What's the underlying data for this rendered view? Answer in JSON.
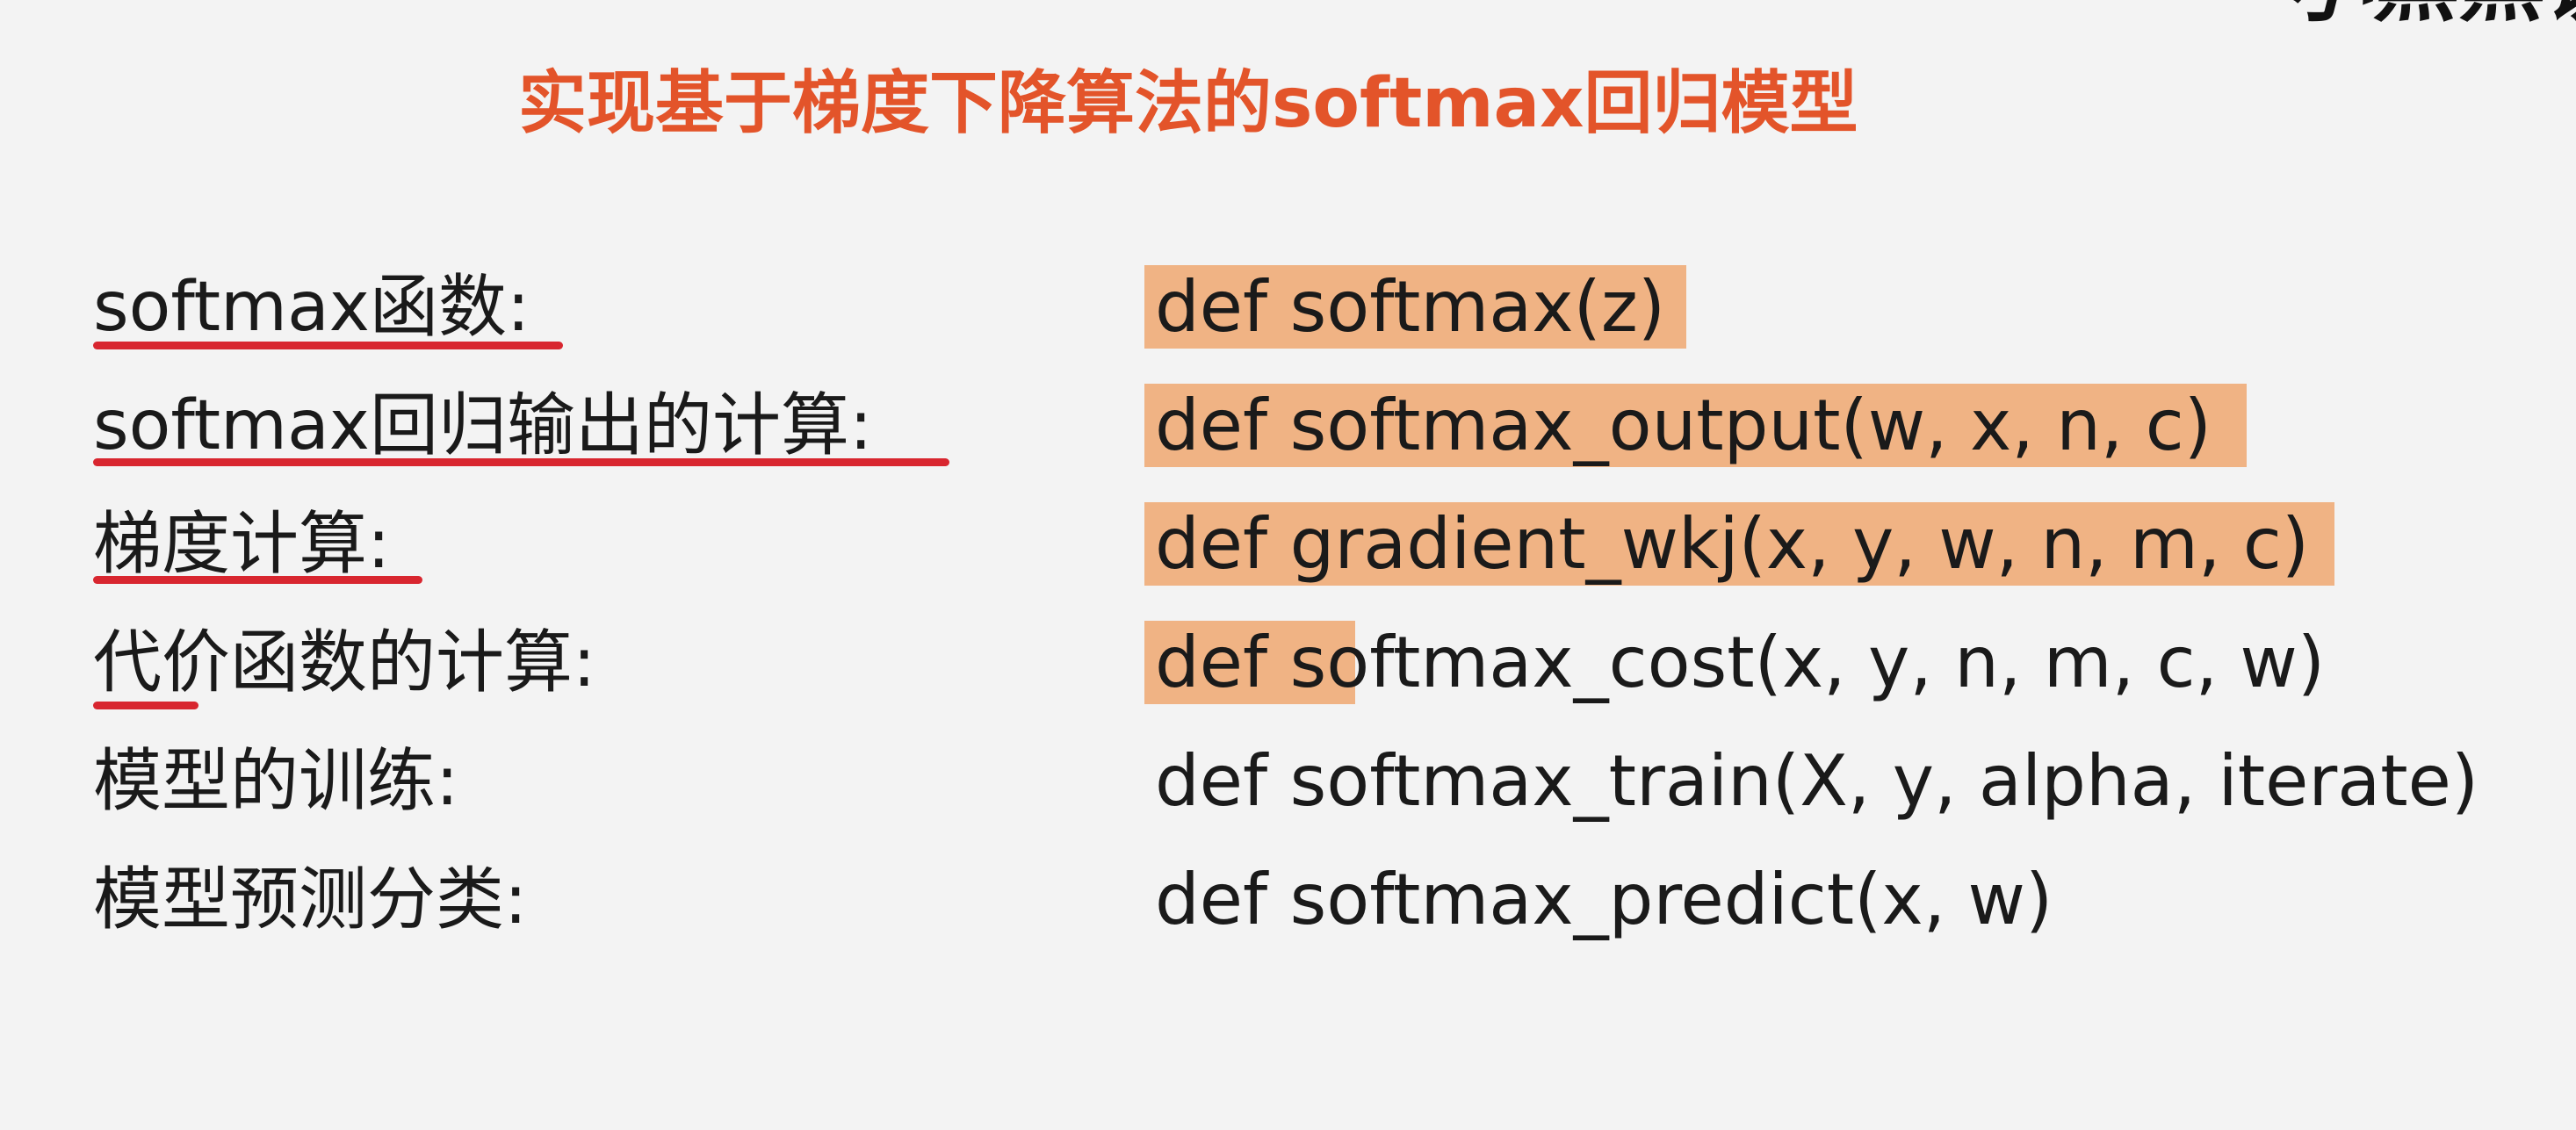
{
  "watermark": "小黑黑讲",
  "title": "实现基于梯度下降算法的softmax回归模型",
  "rows": [
    {
      "label": "softmax函数:",
      "code": "def softmax(z)"
    },
    {
      "label": "softmax回归输出的计算:",
      "code": "def softmax_output(w, x, n, c)"
    },
    {
      "label": "梯度计算:",
      "code": "def gradient_wkj(x, y, w, n, m, c)"
    },
    {
      "label": "代价函数的计算:",
      "code": "def softmax_cost(x, y, n, m, c, w)"
    },
    {
      "label": "模型的训练:",
      "code": "def softmax_train(X, y, alpha, iterate)"
    },
    {
      "label": "模型预测分类:",
      "code": "def softmax_predict(x, w)"
    }
  ],
  "colors": {
    "title": "#e3542a",
    "highlight": "#f0b384",
    "underline": "#d8262f",
    "text": "#1a1a1a",
    "background": "#f3f3f3"
  }
}
